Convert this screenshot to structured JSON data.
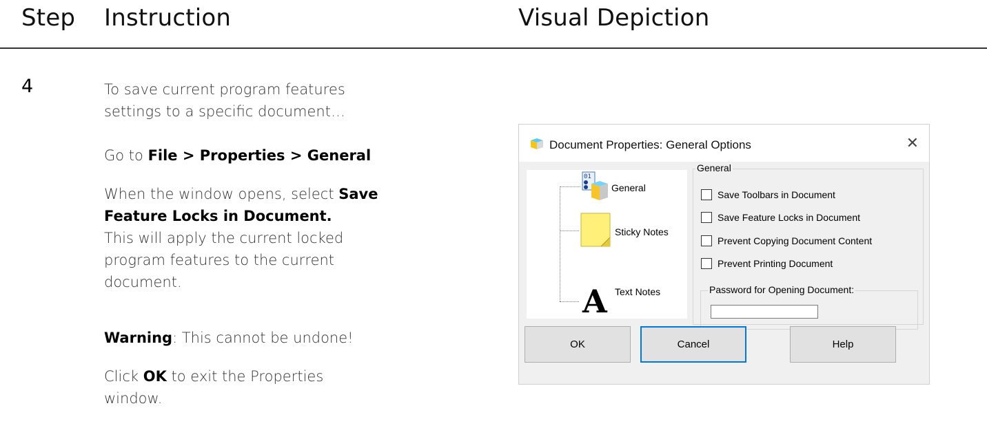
{
  "header": {
    "col_step": "Step",
    "col_instruction": "Instruction",
    "col_visual": "Visual Depiction"
  },
  "step": {
    "number": "4",
    "lines": {
      "l1a": "To save current program features",
      "l1b": "settings to a specific document…",
      "l2_pre": "Go to ",
      "l2_bold": "File > Properties > General",
      "l3_pre": "When the window opens, select ",
      "l3_bold_a": "Save",
      "l3_bold_b": "Feature Locks in Document.",
      "l4a": "This will apply the current locked",
      "l4b": "program features to the current",
      "l4c": "document.",
      "l5_bold": "Warning",
      "l5_rest": ": This cannot be undone!",
      "l6_pre": "Click ",
      "l6_bold": "OK",
      "l6_rest": " to exit the Properties",
      "l6b": "window."
    }
  },
  "dialog": {
    "title": "Document Properties: General Options",
    "close_glyph": "✕",
    "tree": {
      "items": [
        {
          "label": "General",
          "icon": "general-settings-icon"
        },
        {
          "label": "Sticky Notes",
          "icon": "sticky-note-icon"
        },
        {
          "label": "Text Notes",
          "icon": "text-letter-icon"
        }
      ]
    },
    "group_general": "General",
    "checkboxes": [
      {
        "label": "Save Toolbars in Document",
        "checked": false
      },
      {
        "label": "Save Feature Locks in Document",
        "checked": false
      },
      {
        "label": "Prevent Copying Document Content",
        "checked": false
      },
      {
        "label": "Prevent Printing Document",
        "checked": false
      }
    ],
    "password_label": "Password for Opening Document:",
    "password_value": "",
    "buttons": {
      "ok": "OK",
      "cancel": "Cancel",
      "help": "Help"
    },
    "colors": {
      "accent": "#0078d7",
      "sticky": "#fff07a"
    }
  }
}
